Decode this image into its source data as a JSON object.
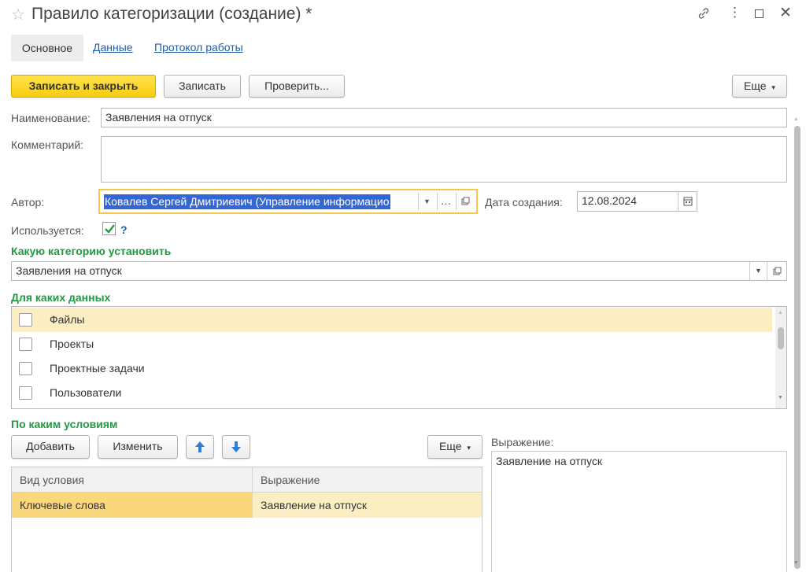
{
  "window": {
    "title": "Правило категоризации (создание) *"
  },
  "tabs": [
    {
      "label": "Основное"
    },
    {
      "label": "Данные"
    },
    {
      "label": "Протокол работы"
    }
  ],
  "toolbar": {
    "save_close": "Записать и закрыть",
    "save": "Записать",
    "check": "Проверить...",
    "more": "Еще"
  },
  "form": {
    "name_label": "Наименование:",
    "name_value": "Заявления на отпуск",
    "comment_label": "Комментарий:",
    "comment_value": "",
    "author_label": "Автор:",
    "author_value": "Ковалев Сергей Дмитриевич (Управление информацио",
    "date_label": "Дата создания:",
    "date_value": "12.08.2024",
    "used_label": "Используется:",
    "used_checked": true,
    "help": "?"
  },
  "category_section": {
    "heading": "Какую категорию установить",
    "value": "Заявления на отпуск"
  },
  "data_section": {
    "heading": "Для каких данных",
    "items": [
      {
        "label": "Файлы",
        "checked": false,
        "selected": true
      },
      {
        "label": "Проекты",
        "checked": false,
        "selected": false
      },
      {
        "label": "Проектные задачи",
        "checked": false,
        "selected": false
      },
      {
        "label": "Пользователи",
        "checked": false,
        "selected": false
      }
    ]
  },
  "conditions": {
    "heading": "По каким условиям",
    "add": "Добавить",
    "edit": "Изменить",
    "more": "Еще",
    "columns": [
      "Вид условия",
      "Выражение"
    ],
    "rows": [
      {
        "type": "Ключевые слова",
        "expression": "Заявление на отпуск"
      }
    ],
    "expr_label": "Выражение:",
    "expr_value": "Заявление на отпуск"
  },
  "colors": {
    "accent_green": "#229944",
    "primary_yellow": "#f7cd0f",
    "selection_row": "#fbeec2",
    "selection_text": "#3366cc",
    "link": "#1d5fa7"
  },
  "icons": [
    "star-icon",
    "link-icon",
    "more-vert-icon",
    "maximize-icon",
    "close-icon",
    "calendar-icon",
    "open-icon",
    "arrow-up-icon",
    "arrow-down-icon",
    "checkmark-icon"
  ]
}
